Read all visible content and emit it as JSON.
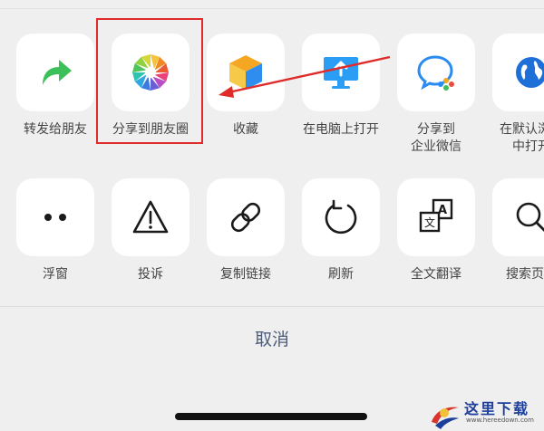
{
  "row1": [
    {
      "id": "forward",
      "label": "转发给朋友",
      "icon": "forward-arrow-icon"
    },
    {
      "id": "moments",
      "label": "分享到朋友圈",
      "icon": "moments-shutter-icon"
    },
    {
      "id": "favorite",
      "label": "收藏",
      "icon": "favorite-cube-icon"
    },
    {
      "id": "open-pc",
      "label": "在电脑上打开",
      "icon": "computer-monitor-icon"
    },
    {
      "id": "wecom",
      "label": "分享到",
      "label2": "企业微信",
      "icon": "wecom-icon"
    },
    {
      "id": "browser",
      "label": "在默认浏览",
      "label2": "中打开",
      "icon": "browser-globe-icon"
    }
  ],
  "row2": [
    {
      "id": "float",
      "label": "浮窗",
      "icon": "float-window-dots-icon"
    },
    {
      "id": "complain",
      "label": "投诉",
      "icon": "warning-triangle-icon"
    },
    {
      "id": "copy-link",
      "label": "复制链接",
      "icon": "link-icon"
    },
    {
      "id": "refresh",
      "label": "刷新",
      "icon": "refresh-icon"
    },
    {
      "id": "translate",
      "label": "全文翻译",
      "icon": "translate-icon"
    },
    {
      "id": "search",
      "label": "搜索页面",
      "icon": "search-icon"
    }
  ],
  "cancel_label": "取消",
  "watermark": {
    "title": "这里下载",
    "url": "www.hereedown.com"
  },
  "colors": {
    "background": "#efefef",
    "tile": "#ffffff",
    "highlight": "#e02b2b",
    "cancel_text": "#4e5d7a",
    "forward_green": "#3dbf5a"
  }
}
